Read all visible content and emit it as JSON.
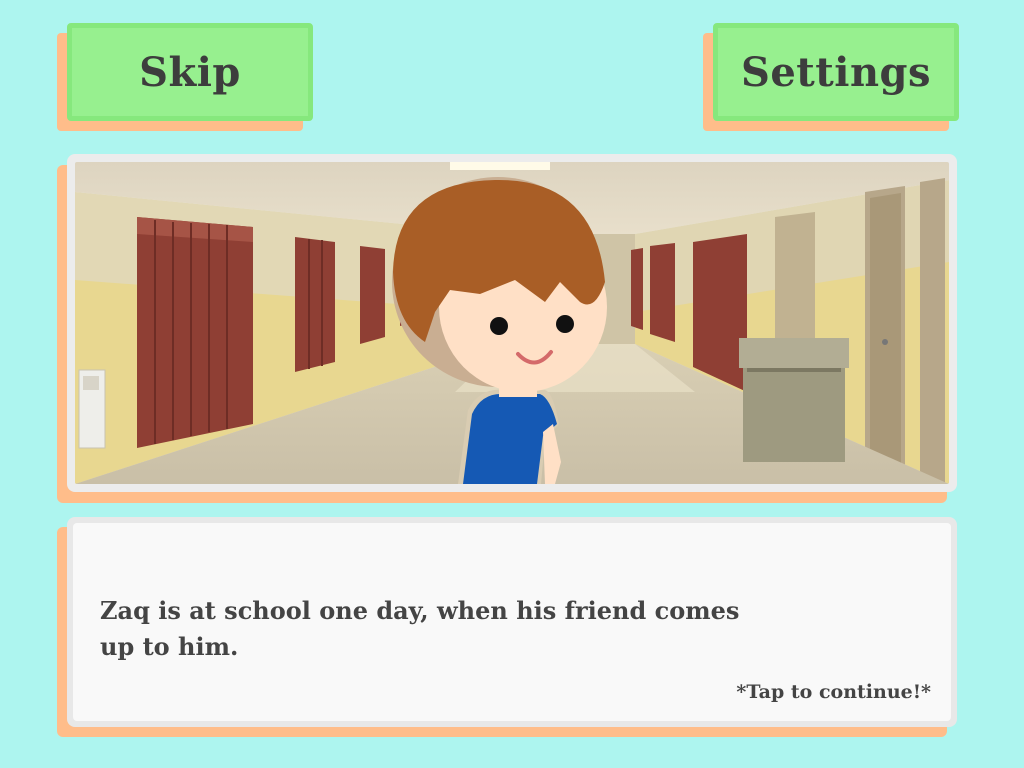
{
  "top_bar": {
    "skip_label": "Skip",
    "settings_label": "Settings"
  },
  "scene": {
    "background": "school-hallway",
    "character": "zaq"
  },
  "dialogue": {
    "text": "Zaq is at school one day, when his friend comes up to him.",
    "continue_hint": "*Tap to continue!*"
  },
  "colors": {
    "background": "#adf5ef",
    "button_fill": "#97f08f",
    "button_border": "#86e87d",
    "shadow": "#ffbd8a",
    "text": "#444444",
    "panel": "#f9f9f9"
  }
}
